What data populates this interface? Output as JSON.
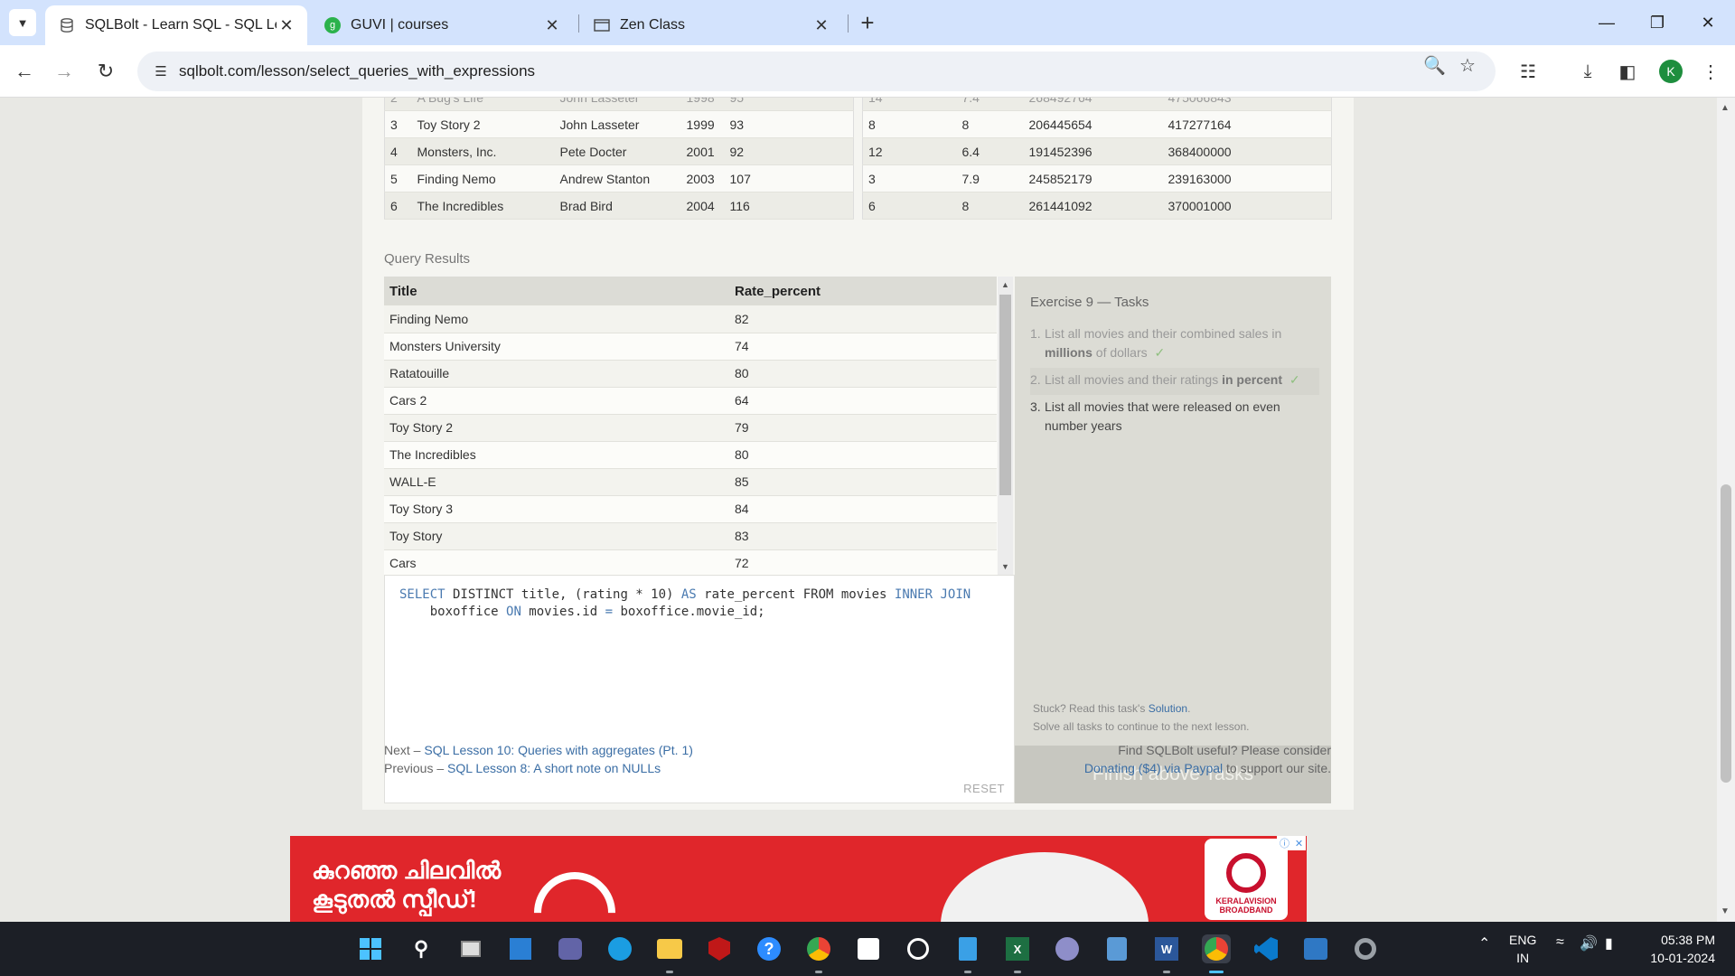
{
  "browser": {
    "tabs": [
      {
        "title": "SQLBolt - Learn SQL - SQL Less",
        "active": true
      },
      {
        "title": "GUVI | courses",
        "active": false
      },
      {
        "title": "Zen Class",
        "active": false
      }
    ],
    "url": "sqlbolt.com/lesson/select_queries_with_expressions",
    "profile_initial": "K"
  },
  "movies_table": [
    {
      "id": "3",
      "title": "Toy Story 2",
      "director": "John Lasseter",
      "year": "1999",
      "length": "93"
    },
    {
      "id": "4",
      "title": "Monsters, Inc.",
      "director": "Pete Docter",
      "year": "2001",
      "length": "92"
    },
    {
      "id": "5",
      "title": "Finding Nemo",
      "director": "Andrew Stanton",
      "year": "2003",
      "length": "107"
    },
    {
      "id": "6",
      "title": "The Incredibles",
      "director": "Brad Bird",
      "year": "2004",
      "length": "116"
    }
  ],
  "boxoffice_table": [
    {
      "movie_id": "8",
      "rating": "8",
      "domestic": "206445654",
      "international": "417277164"
    },
    {
      "movie_id": "12",
      "rating": "6.4",
      "domestic": "191452396",
      "international": "368400000"
    },
    {
      "movie_id": "3",
      "rating": "7.9",
      "domestic": "245852179",
      "international": "239163000"
    },
    {
      "movie_id": "6",
      "rating": "8",
      "domestic": "261441092",
      "international": "370001000"
    }
  ],
  "query_results": {
    "label": "Query Results",
    "headers": [
      "Title",
      "Rate_percent"
    ],
    "rows": [
      [
        "Finding Nemo",
        "82"
      ],
      [
        "Monsters University",
        "74"
      ],
      [
        "Ratatouille",
        "80"
      ],
      [
        "Cars 2",
        "64"
      ],
      [
        "Toy Story 2",
        "79"
      ],
      [
        "The Incredibles",
        "80"
      ],
      [
        "WALL-E",
        "85"
      ],
      [
        "Toy Story 3",
        "84"
      ],
      [
        "Toy Story",
        "83"
      ],
      [
        "Cars",
        "72"
      ]
    ]
  },
  "editor": {
    "reset_label": "RESET"
  },
  "tasks": {
    "title": "Exercise 9 — Tasks",
    "stuck_prefix": "Stuck? Read this task's ",
    "solution_link": "Solution",
    "stuck_suffix": ".",
    "solve_all": "Solve all tasks to continue to the next lesson.",
    "finish_label": "Finish above Tasks"
  },
  "footer": {
    "next_prefix": "Next – ",
    "next_link": "SQL Lesson 10: Queries with aggregates (Pt. 1)",
    "prev_prefix": "Previous – ",
    "prev_link": "SQL Lesson 8: A short note on NULLs",
    "useful": "Find SQLBolt useful? Please consider",
    "donate_link": "Donating ($4) via Paypal",
    "donate_suffix": " to support our site."
  },
  "ad": {
    "line1": "കുറഞ്ഞ ചിലവിൽ",
    "line2": "കൂടുതൽ സ്പീഡ്!",
    "brand": "KERALAVISION BROADBAND"
  },
  "taskbar": {
    "lang1": "ENG",
    "lang2": "IN",
    "time": "05:38 PM",
    "date": "10-01-2024"
  }
}
